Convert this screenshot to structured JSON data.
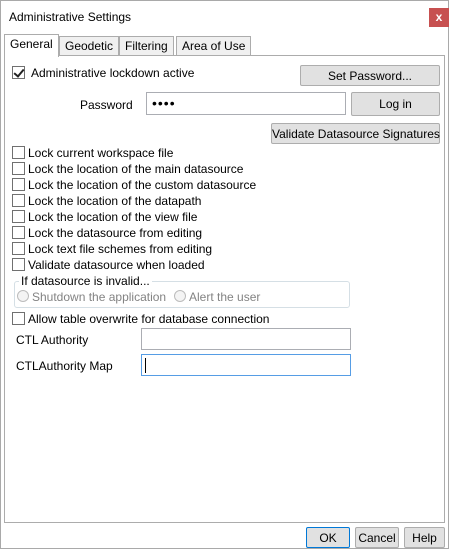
{
  "window": {
    "title": "Administrative Settings",
    "close_glyph": "x"
  },
  "tabs": [
    {
      "label": "General",
      "active": true
    },
    {
      "label": "Geodetic",
      "active": false
    },
    {
      "label": "Filtering",
      "active": false
    },
    {
      "label": "Area of Use",
      "active": false
    }
  ],
  "general": {
    "lockdown": {
      "label": "Administrative lockdown active",
      "checked": true
    },
    "set_password_label": "Set Password...",
    "password": {
      "label": "Password",
      "value": "••••"
    },
    "login_label": "Log in",
    "validate_signatures_label": "Validate Datasource Signatures",
    "options": [
      {
        "label": "Lock current workspace file",
        "checked": false
      },
      {
        "label": "Lock the location of the main datasource",
        "checked": false
      },
      {
        "label": "Lock the location of the custom datasource",
        "checked": false
      },
      {
        "label": "Lock the location of the datapath",
        "checked": false
      },
      {
        "label": "Lock the location of the view file",
        "checked": false
      },
      {
        "label": "Lock the datasource from editing",
        "checked": false
      },
      {
        "label": "Lock text file schemes from editing",
        "checked": false
      },
      {
        "label": "Validate datasource when loaded",
        "checked": false
      }
    ],
    "invalid_group": {
      "title": "If datasource is invalid...",
      "options": [
        "Shutdown the application",
        "Alert the user"
      ]
    },
    "allow_overwrite": {
      "label": "Allow table overwrite for database connection",
      "checked": false
    },
    "ctl_authority": {
      "label": "CTL Authority",
      "value": ""
    },
    "ctl_authority_map": {
      "label": "CTLAuthority Map",
      "value": ""
    }
  },
  "footer": {
    "ok_label": "OK",
    "cancel_label": "Cancel",
    "help_label": "Help"
  },
  "colors": {
    "close_button": "#c75050",
    "focus_border": "#569de5",
    "default_button_border": "#0078d7"
  }
}
